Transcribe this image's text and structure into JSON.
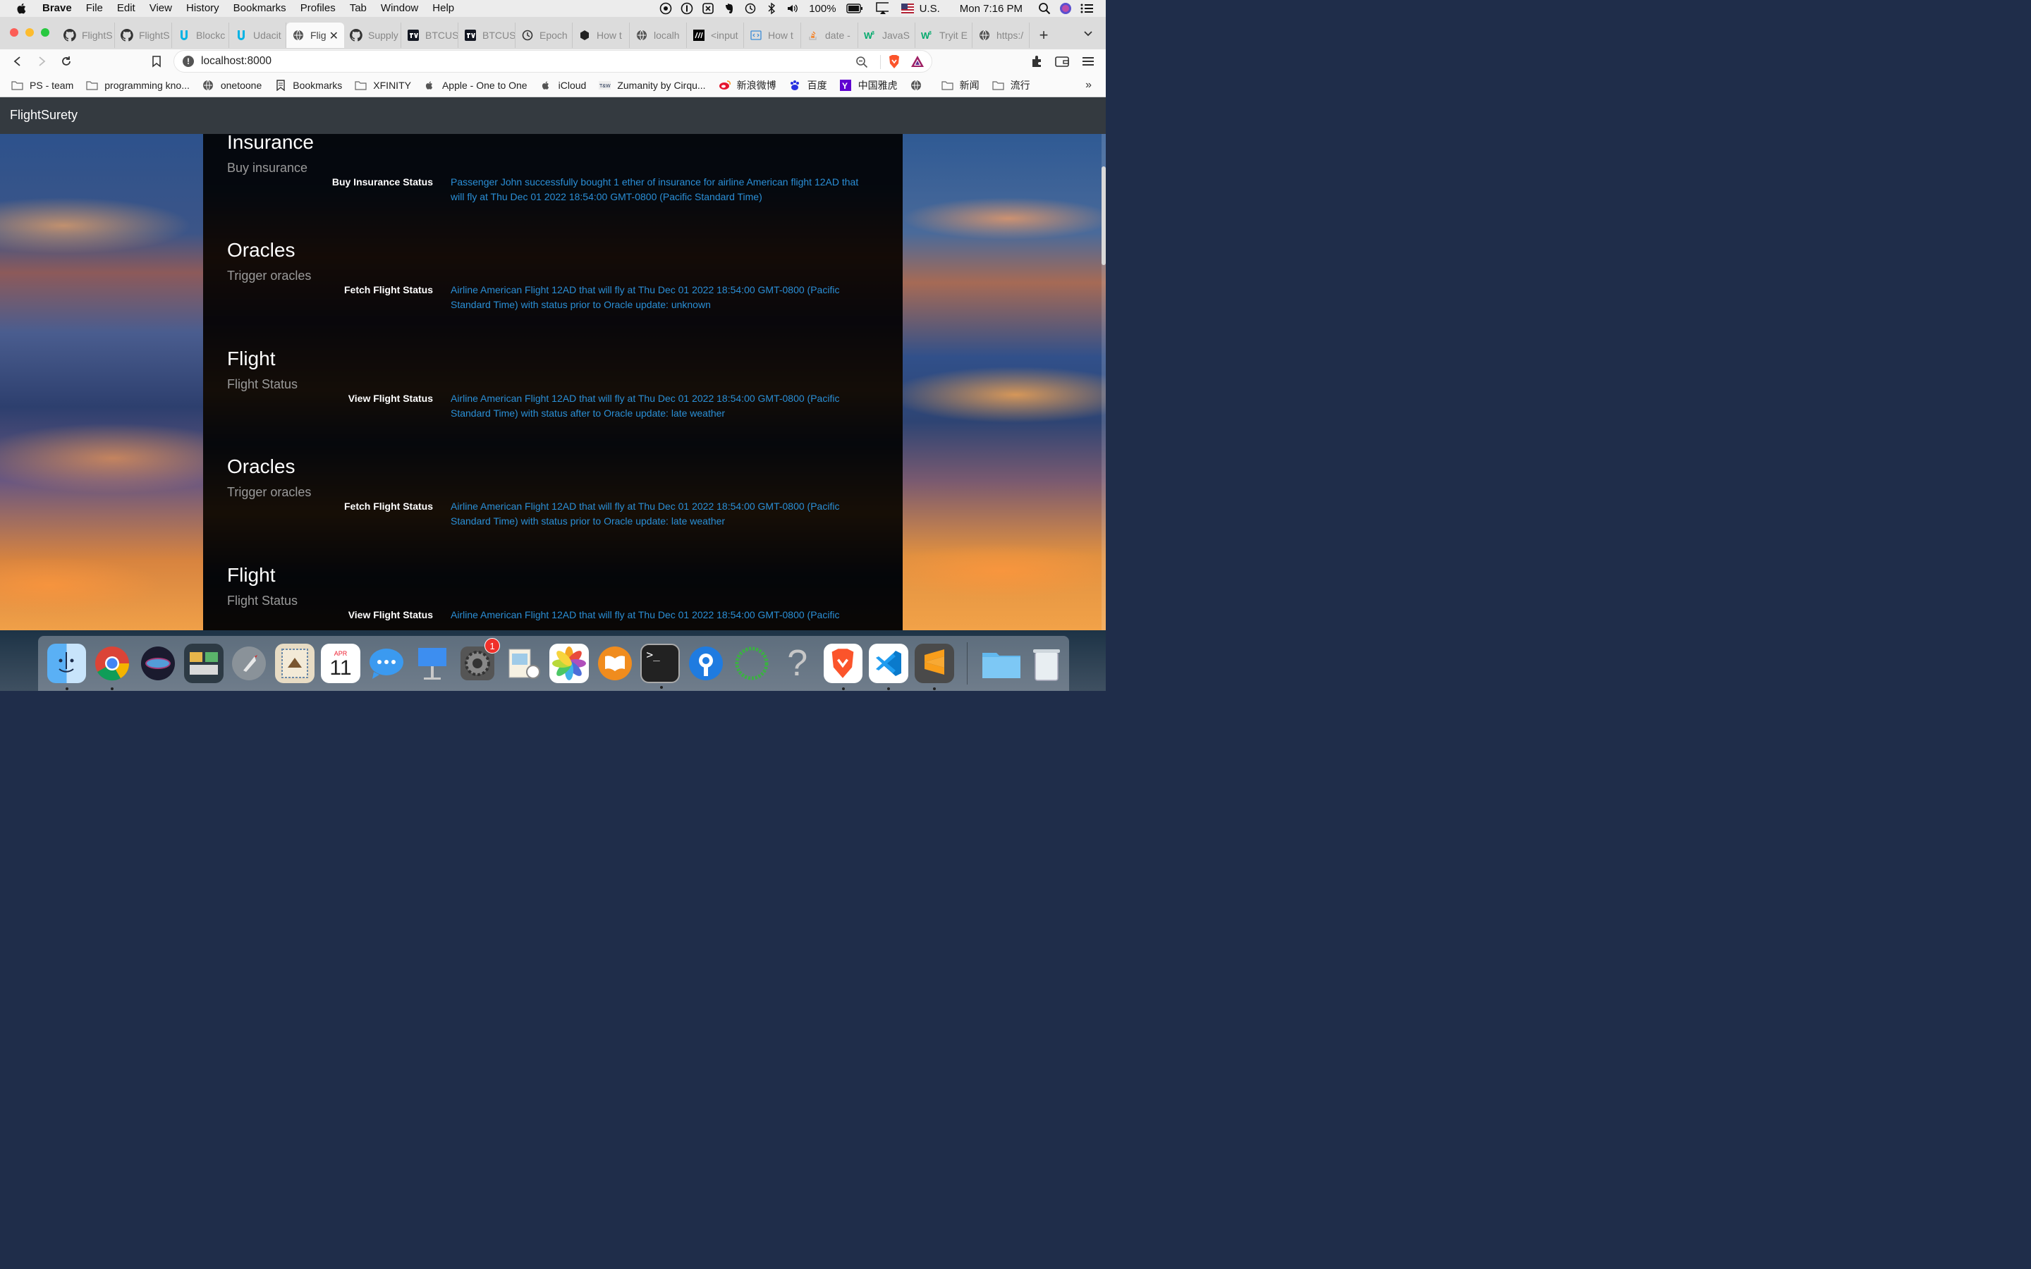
{
  "menubar": {
    "app_name": "Brave",
    "items": [
      "File",
      "Edit",
      "View",
      "History",
      "Bookmarks",
      "Profiles",
      "Tab",
      "Window",
      "Help"
    ],
    "battery": "100%",
    "input_source": "U.S.",
    "clock": "Mon 7:16 PM"
  },
  "tabs": [
    {
      "label": "FlightS",
      "icon": "github-icon"
    },
    {
      "label": "FlightS",
      "icon": "github-icon"
    },
    {
      "label": "Blockc",
      "icon": "udacity-icon"
    },
    {
      "label": "Udacit",
      "icon": "udacity-icon"
    },
    {
      "label": "Flig",
      "icon": "globe-icon",
      "active": true
    },
    {
      "label": "Supply",
      "icon": "github-icon"
    },
    {
      "label": "BTCUS",
      "icon": "tradingview-icon"
    },
    {
      "label": "BTCUS",
      "icon": "tradingview-icon"
    },
    {
      "label": "Epoch",
      "icon": "clock-icon"
    },
    {
      "label": "How t",
      "icon": "hexagon-icon"
    },
    {
      "label": "localh",
      "icon": "globe-icon"
    },
    {
      "label": "<input",
      "icon": "mdn-icon"
    },
    {
      "label": "How t",
      "icon": "code-icon"
    },
    {
      "label": "date -",
      "icon": "stackoverflow-icon"
    },
    {
      "label": "JavaS",
      "icon": "w3schools-icon"
    },
    {
      "label": "Tryit E",
      "icon": "w3schools-icon"
    },
    {
      "label": "https:/",
      "icon": "globe-icon"
    }
  ],
  "toolbar": {
    "url": "localhost:8000"
  },
  "bookmarks": [
    {
      "label": "PS - team",
      "icon": "folder-icon"
    },
    {
      "label": "programming kno...",
      "icon": "folder-icon"
    },
    {
      "label": "onetoone",
      "icon": "globe-icon"
    },
    {
      "label": "Bookmarks",
      "icon": "bookmark-icon"
    },
    {
      "label": "XFINITY",
      "icon": "folder-icon"
    },
    {
      "label": "Apple - One to One",
      "icon": "apple-icon"
    },
    {
      "label": "iCloud",
      "icon": "apple-icon"
    },
    {
      "label": "Zumanity by Cirqu...",
      "icon": "tw-icon"
    },
    {
      "label": "新浪微博",
      "icon": "weibo-icon"
    },
    {
      "label": "百度",
      "icon": "baidu-icon"
    },
    {
      "label": "中国雅虎",
      "icon": "yahoo-icon"
    },
    {
      "label": "",
      "icon": "globe-icon"
    },
    {
      "label": "新闻",
      "icon": "folder-icon"
    },
    {
      "label": "流行",
      "icon": "folder-icon"
    }
  ],
  "app": {
    "brand": "FlightSurety",
    "sections": [
      {
        "title": "Insurance",
        "subtitle": "Buy insurance",
        "label": "Buy Insurance Status",
        "value": "Passenger John successfully bought 1 ether of insurance for airline American flight 12AD that will fly at Thu Dec 01 2022 18:54:00 GMT-0800 (Pacific Standard Time)"
      },
      {
        "title": "Oracles",
        "subtitle": "Trigger oracles",
        "label": "Fetch Flight Status",
        "value": "Airline American Flight 12AD that will fly at Thu Dec 01 2022 18:54:00 GMT-0800 (Pacific Standard Time) with status prior to Oracle update: unknown"
      },
      {
        "title": "Flight",
        "subtitle": "Flight Status",
        "label": "View Flight Status",
        "value": "Airline American Flight 12AD that will fly at Thu Dec 01 2022 18:54:00 GMT-0800 (Pacific Standard Time) with status after to Oracle update: late weather"
      },
      {
        "title": "Oracles",
        "subtitle": "Trigger oracles",
        "label": "Fetch Flight Status",
        "value": "Airline American Flight 12AD that will fly at Thu Dec 01 2022 18:54:00 GMT-0800 (Pacific Standard Time) with status prior to Oracle update: late weather"
      },
      {
        "title": "Flight",
        "subtitle": "Flight Status",
        "label": "View Flight Status",
        "value": "Airline American Flight 12AD that will fly at Thu Dec 01 2022 18:54:00 GMT-0800 (Pacific"
      }
    ]
  },
  "dock": {
    "apps": [
      "finder-icon",
      "chrome-icon",
      "siri-icon",
      "image-capture-icon",
      "launchpad-icon",
      "mail-icon",
      "calendar-icon",
      "messages-icon",
      "keynote-icon",
      "system-preferences-icon",
      "preview-icon",
      "photos-icon",
      "books-icon",
      "terminal-icon",
      "sourcetree-icon",
      "activity-icon",
      "help-icon",
      "brave-icon",
      "vscode-icon",
      "sublime-icon"
    ],
    "calendar_month": "APR",
    "calendar_day": "11",
    "sysprefs_badge": "1"
  },
  "colors": {
    "accent_link": "#2a8fd6",
    "navbar": "#343a40",
    "panel": "#000000"
  }
}
